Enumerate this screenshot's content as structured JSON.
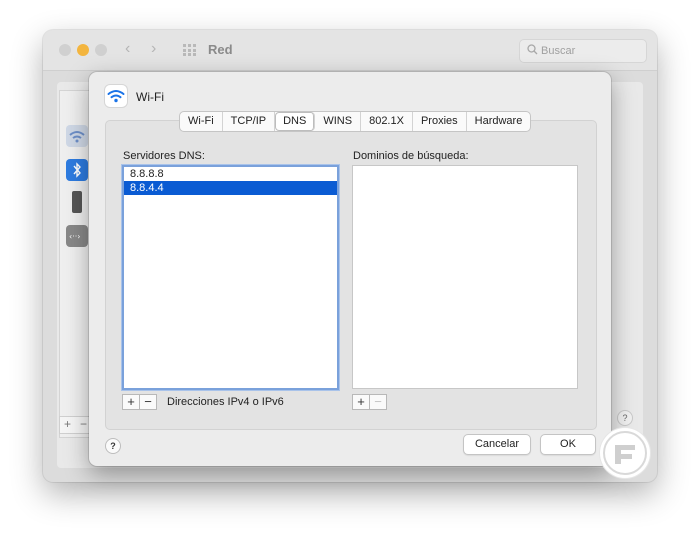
{
  "background_window": {
    "title": "Red",
    "search_placeholder": "Buscar"
  },
  "sheet": {
    "title": "Wi-Fi",
    "tabs": [
      {
        "label": "Wi-Fi",
        "active": false
      },
      {
        "label": "TCP/IP",
        "active": false
      },
      {
        "label": "DNS",
        "active": true
      },
      {
        "label": "WINS",
        "active": false
      },
      {
        "label": "802.1X",
        "active": false
      },
      {
        "label": "Proxies",
        "active": false
      },
      {
        "label": "Hardware",
        "active": false
      }
    ],
    "dns": {
      "label": "Servidores DNS:",
      "servers": [
        {
          "value": "8.8.8.8",
          "selected": false
        },
        {
          "value": "8.8.4.4",
          "selected": true
        }
      ],
      "add_label": "+",
      "remove_label": "−",
      "hint": "Direcciones IPv4 o IPv6"
    },
    "search_domains": {
      "label": "Dominios de búsqueda:",
      "add_label": "+",
      "remove_label": "−"
    },
    "help_label": "?",
    "cancel_label": "Cancelar",
    "ok_label": "OK"
  },
  "colors": {
    "selection": "#0a5bd3",
    "focus_ring": "#7aa1db",
    "wifi_icon": "#1a73e8",
    "minimize_light": "#f3b53f"
  }
}
